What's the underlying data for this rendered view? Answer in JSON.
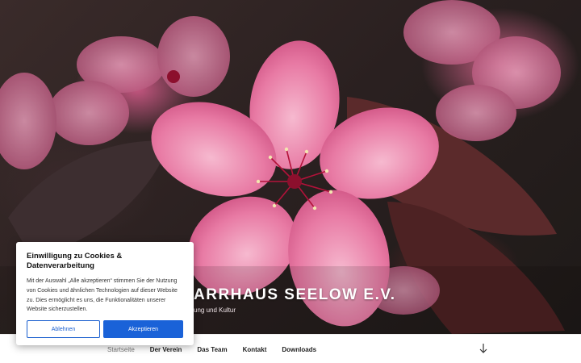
{
  "hero": {
    "image": "pink-apple-blossom-photo",
    "colors": {
      "petal": "#e87aa4",
      "petal_light": "#f6b9cf",
      "leaf": "#5a2426",
      "stamen": "#b3123a"
    }
  },
  "site": {
    "title_visible": "ARRHAUS SEELOW E.V.",
    "description_visible": "ung und Kultur"
  },
  "nav": {
    "items": [
      {
        "label": "Startseite",
        "current": true
      },
      {
        "label": "Der Verein"
      },
      {
        "label": "Das Team"
      },
      {
        "label": "Kontakt"
      },
      {
        "label": "Downloads"
      }
    ],
    "scroll_icon": "arrow-down-icon"
  },
  "cookie": {
    "title": "Einwilligung zu Cookies & Datenverarbeitung",
    "text": "Mit der Auswahl „Alle akzeptieren“ stimmen Sie der Nutzung von Cookies und ähnlichen Technologien auf dieser Website zu. Dies ermöglicht es uns, die Funktionalitäten unserer Website sicherzustellen.",
    "reject_label": "Ablehnen",
    "accept_label": "Akzeptieren",
    "accent": "#1a62d8"
  }
}
